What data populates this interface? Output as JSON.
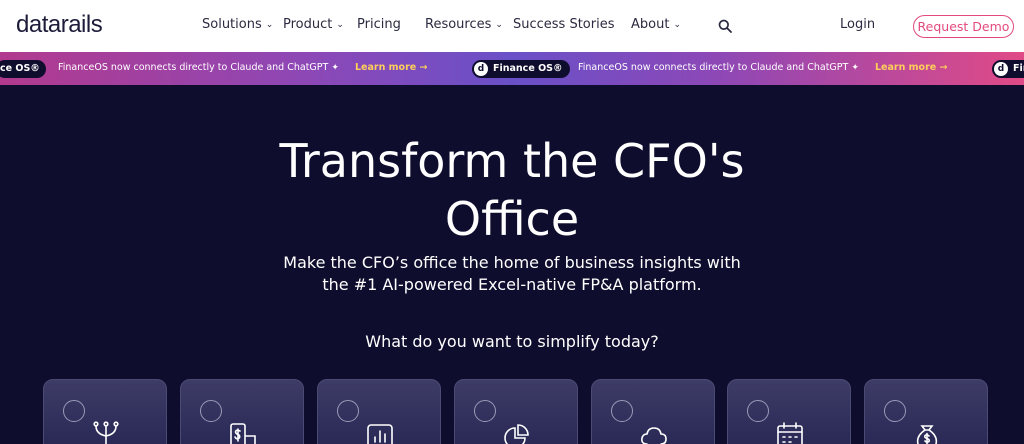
{
  "nav": {
    "logo": "datarails",
    "items": [
      {
        "label": "Solutions",
        "has_dropdown": true
      },
      {
        "label": "Product",
        "has_dropdown": true
      },
      {
        "label": "Pricing",
        "has_dropdown": false
      },
      {
        "label": "Resources",
        "has_dropdown": true
      },
      {
        "label": "Success Stories",
        "has_dropdown": false
      },
      {
        "label": "About",
        "has_dropdown": true
      }
    ],
    "search_icon": "search-icon",
    "login_label": "Login",
    "demo_label": "Request Demo",
    "chevron": "⌄"
  },
  "banner": {
    "pill_label": "Finance OS®",
    "pill_label_cut": "ce OS®",
    "pill_label_cut_right": "Fin",
    "badge_glyph": "d",
    "message": "FinanceOS now connects directly to Claude and ChatGPT",
    "sparkle": "✦",
    "learn_more": "Learn more →"
  },
  "hero": {
    "title_line1": "Transform the CFO's",
    "title_line2": "Office",
    "subtitle_line1": "Make the CFO’s office the home of business insights with",
    "subtitle_line2": "the #1 AI-powered Excel-native FP&A platform.",
    "question": "What do you want to simplify today?"
  },
  "cards": [
    {
      "icon": "branch-icon"
    },
    {
      "icon": "dollar-document-icon"
    },
    {
      "icon": "bar-chart-icon"
    },
    {
      "icon": "pie-chart-icon"
    },
    {
      "icon": "cloud-icon"
    },
    {
      "icon": "calendar-icon"
    },
    {
      "icon": "money-bag-icon"
    }
  ],
  "colors": {
    "background": "#0f0d2e",
    "accent": "#e24a7d",
    "learn_more": "#ffcf5a"
  }
}
